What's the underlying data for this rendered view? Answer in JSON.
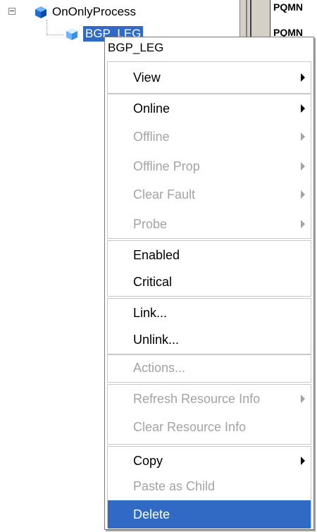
{
  "tree": {
    "parent_label": "OnOnlyProcess",
    "child_label": "BGP_LEG"
  },
  "grid": {
    "row1": "PQMN",
    "row2": "PQMN"
  },
  "menu": {
    "header": "BGP_LEG",
    "view": "View",
    "online": "Online",
    "offline": "Offline",
    "offline_prop": "Offline Prop",
    "clear_fault": "Clear Fault",
    "probe": "Probe",
    "enabled": "Enabled",
    "critical": "Critical",
    "link": "Link...",
    "unlink": "Unlink...",
    "actions": "Actions...",
    "refresh_resource_info": "Refresh Resource Info",
    "clear_resource_info": "Clear Resource Info",
    "copy": "Copy",
    "paste_as_child": "Paste as Child",
    "delete": "Delete"
  },
  "colors": {
    "selection": "#316ac5",
    "disabled_text": "#a3a3a3"
  }
}
